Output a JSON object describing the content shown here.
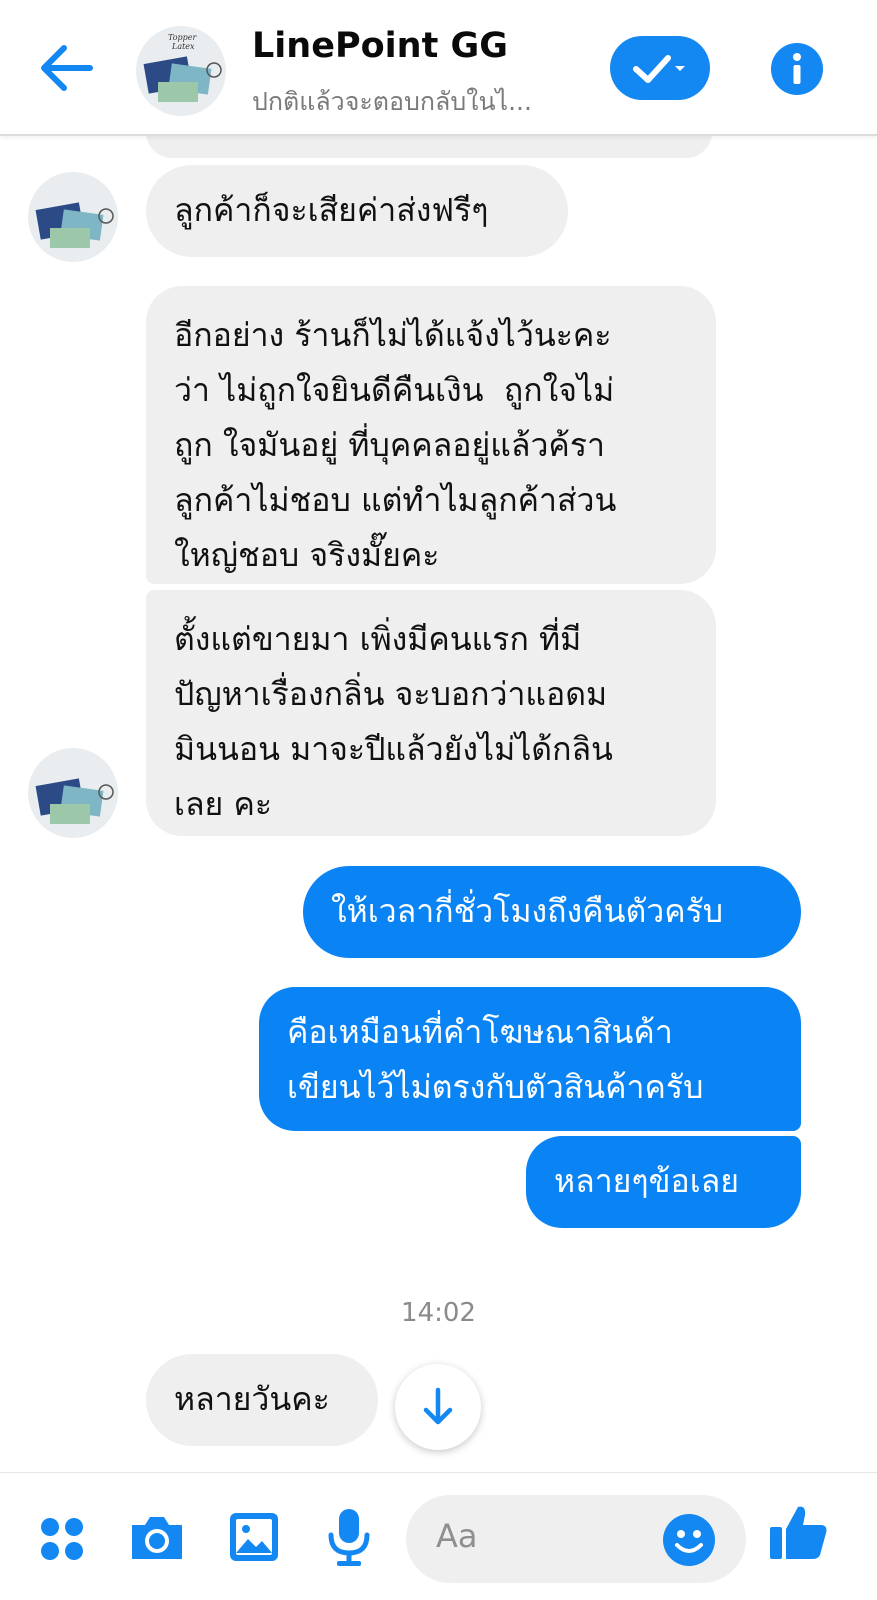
{
  "header": {
    "title": "LinePoint GG",
    "subtitle": "ปกติแล้วจะตอบกลับในไ..."
  },
  "avatar_logo": {
    "line1": "Topper",
    "line2": "Latex"
  },
  "messages": [
    {
      "from": "them",
      "text": "ลูกค้าก็จะเสียค่าส่งฟรีๆ"
    },
    {
      "from": "them",
      "text": "อีกอย่าง ร้านก็ไม่ได้แจ้งไว้นะคะ\nว่า ไม่ถูกใจยินดีคืนเงิน  ถูกใจไม่\nถูก ใจมันอยู่ ที่บุคคลอยู่แล้วค้รา\nลูกค้าไม่ชอบ แต่ทำไมลูกค้าส่วน\nใหญ่ชอบ จริงมั๊ยคะ"
    },
    {
      "from": "them",
      "text": "ตั้งแต่ขายมา เพิ่งมีคนแรก ที่มี\nปัญหาเรื่องกลิ่น จะบอกว่าแอดม\nมินนอน มาจะปีแล้วยังไม่ได้กลิน\nเลย คะ"
    },
    {
      "from": "me",
      "text": "ให้เวลากี่ชั่วโมงถึงคืนตัวครับ"
    },
    {
      "from": "me",
      "text": "คือเหมือนที่คำโฆษณาสินค้า\nเขียนไว้ไม่ตรงกับตัวสินค้าครับ"
    },
    {
      "from": "me",
      "text": "หลายๆข้อเลย"
    },
    {
      "from": "them",
      "text": "หลายวันคะ"
    }
  ],
  "timestamp": "14:02",
  "composer": {
    "placeholder": "Aa"
  },
  "colors": {
    "accent": "#0a84f4",
    "incoming_bubble": "#efefef",
    "header_icon": "#1488f2"
  }
}
